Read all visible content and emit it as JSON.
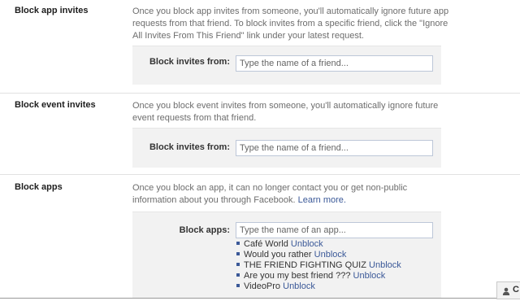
{
  "sections": [
    {
      "title": "Block app invites",
      "description": "Once you block app invites from someone, you'll automatically ignore future app requests from that friend. To block invites from a specific friend, click the \"Ignore All Invites From This Friend\" link under your latest request.",
      "field_label": "Block invites from:",
      "placeholder": "Type the name of a friend..."
    },
    {
      "title": "Block event invites",
      "description": "Once you block event invites from someone, you'll automatically ignore future event requests from that friend.",
      "field_label": "Block invites from:",
      "placeholder": "Type the name of a friend..."
    },
    {
      "title": "Block apps",
      "description": "Once you block an app, it can no longer contact you or get non-public information about you through Facebook.",
      "learn_more": "Learn more.",
      "field_label": "Block apps:",
      "placeholder": "Type the name of an app...",
      "blocked_items": [
        {
          "name": "Café World",
          "action": "Unblock"
        },
        {
          "name": "Would you rather",
          "action": "Unblock"
        },
        {
          "name": "THE FRIEND FIGHTING QUIZ",
          "action": "Unblock"
        },
        {
          "name": "Are you my best friend ???",
          "action": "Unblock"
        },
        {
          "name": "VideoPro",
          "action": "Unblock"
        }
      ]
    }
  ],
  "chat": {
    "label": "C",
    "icon": "person-icon"
  },
  "colors": {
    "link": "#3b5998",
    "panel": "#f2f2f2",
    "input_border": "#bdc7d8"
  }
}
